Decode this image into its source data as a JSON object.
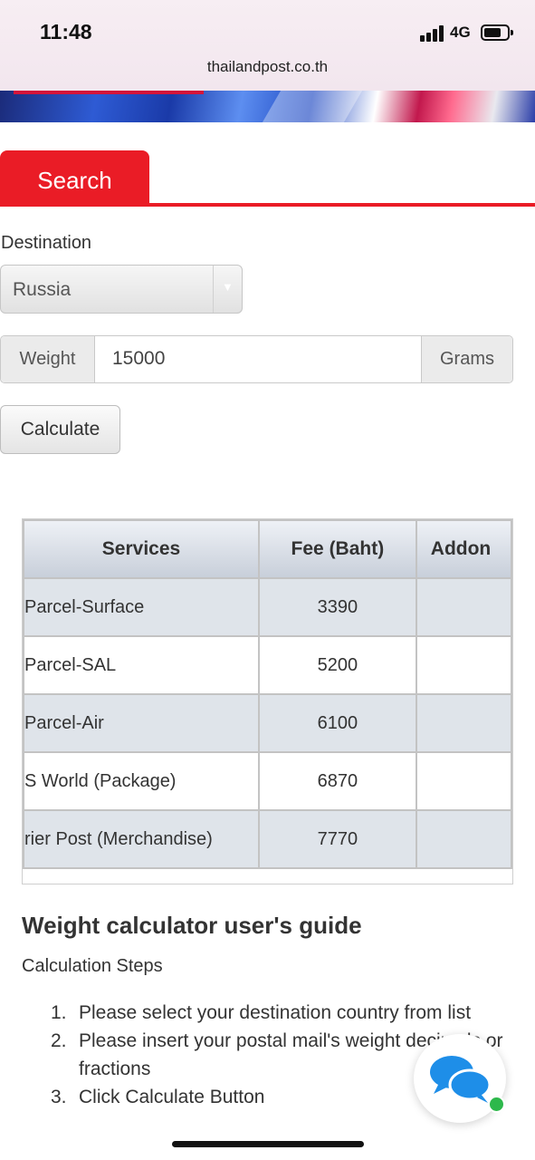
{
  "status_bar": {
    "time": "11:48",
    "network": "4G"
  },
  "browser": {
    "url": "thailandpost.co.th"
  },
  "tab": {
    "label": "Search"
  },
  "form": {
    "destination_label": "Destination",
    "destination_value": "Russia",
    "weight_label": "Weight",
    "weight_value": "15000",
    "weight_unit": "Grams",
    "calculate_label": "Calculate"
  },
  "table": {
    "headers": [
      "Services",
      "Fee (Baht)",
      "Addon"
    ],
    "rows": [
      {
        "service": "Parcel-Surface",
        "fee": "3390"
      },
      {
        "service": "Parcel-SAL",
        "fee": "5200"
      },
      {
        "service": "Parcel-Air",
        "fee": "6100"
      },
      {
        "service": "S World (Package)",
        "fee": "6870"
      },
      {
        "service": "rier Post (Merchandise)",
        "fee": "7770"
      }
    ]
  },
  "guide": {
    "title": "Weight calculator user's guide",
    "subtitle": "Calculation Steps",
    "steps": [
      {
        "num": "1.",
        "text": "Please select your destination country from list"
      },
      {
        "num": "2.",
        "text": "Please insert your postal mail's weight decimals or fractions"
      },
      {
        "num": "3.",
        "text": "Click Calculate Button"
      }
    ]
  },
  "colors": {
    "brand_red": "#ea1c26",
    "chat_blue": "#1e8ee8",
    "online_green": "#2db84b"
  },
  "icons": {
    "chat": "chat-bubbles-icon"
  }
}
